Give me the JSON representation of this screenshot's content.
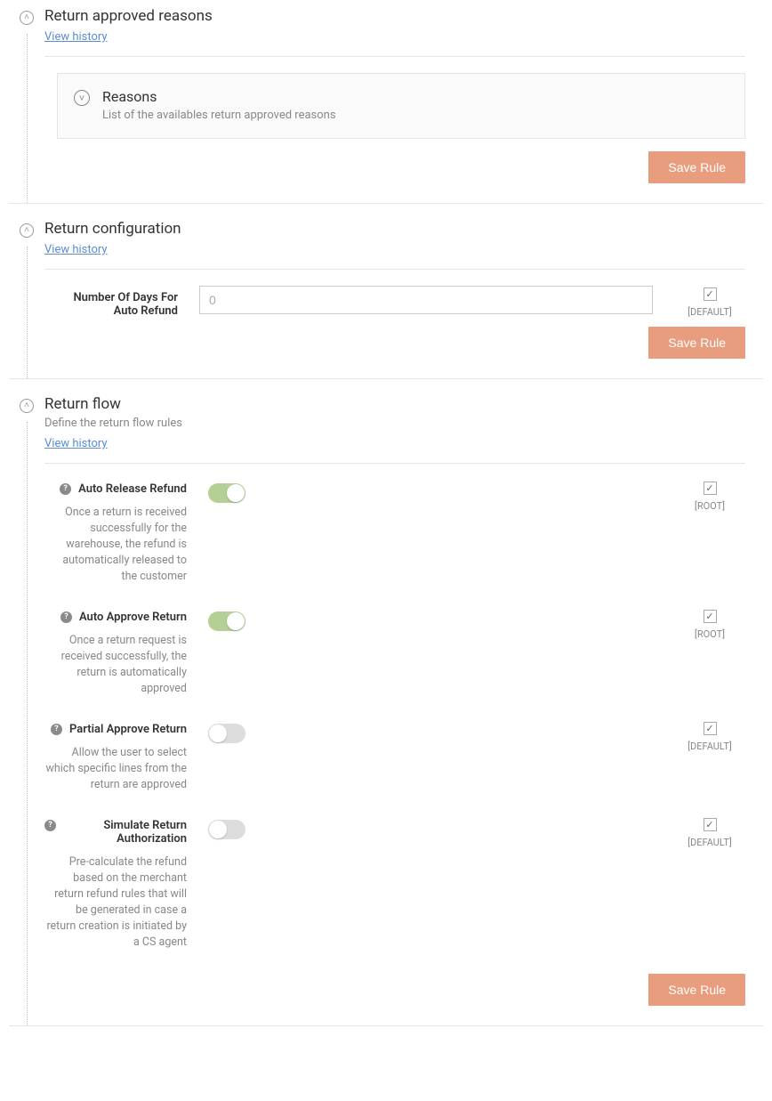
{
  "common": {
    "view_history": "View history",
    "save_rule": "Save Rule"
  },
  "approved_reasons": {
    "title": "Return approved reasons",
    "card_title": "Reasons",
    "card_desc": "List of the availables return approved reasons"
  },
  "return_config": {
    "title": "Return configuration",
    "field_label_l1": "Number Of Days For",
    "field_label_l2": "Auto Refund",
    "placeholder": "0",
    "meta": "[DEFAULT]"
  },
  "return_flow": {
    "title": "Return flow",
    "subtitle": "Define the return flow rules",
    "rows": [
      {
        "label": "Auto Release Refund",
        "desc": "Once a return is received successfully for the warehouse, the refund is automatically released to the customer",
        "on": true,
        "meta": "[ROOT]"
      },
      {
        "label": "Auto Approve Return",
        "desc": "Once a return request is received successfully, the return is automatically approved",
        "on": true,
        "meta": "[ROOT]"
      },
      {
        "label": "Partial Approve Return",
        "desc": "Allow the user to select which specific lines from the return are approved",
        "on": false,
        "meta": "[DEFAULT]"
      },
      {
        "label": "Simulate Return Authorization",
        "desc": "Pre-calculate the refund based on the merchant return refund rules that will be generated in case a return creation is initiated by a CS agent",
        "on": false,
        "meta": "[DEFAULT]"
      }
    ]
  }
}
